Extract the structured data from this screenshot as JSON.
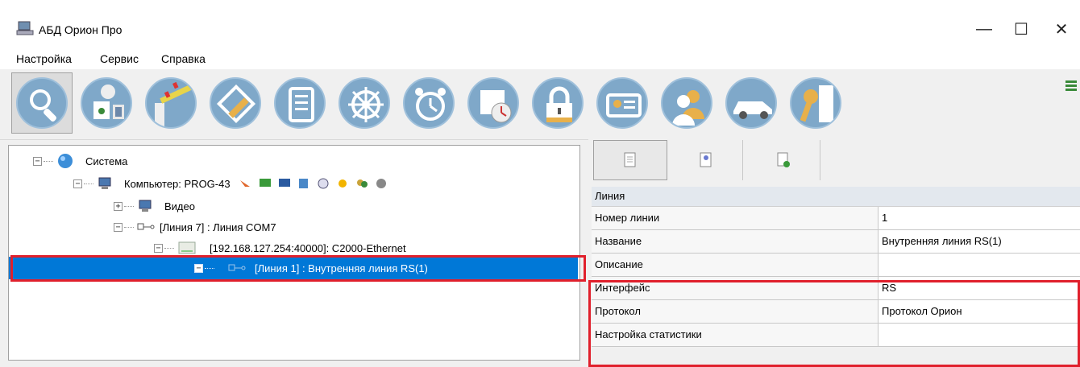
{
  "window": {
    "title": "АБД Орион Про",
    "minimize": "—",
    "maximize": "☐",
    "close": "✕"
  },
  "menu": [
    "Настройка",
    "Сервис",
    "Справка"
  ],
  "toolbar_icons": [
    "search-icon",
    "camera-icon",
    "barrier-icon",
    "plan-edit-icon",
    "document-icon",
    "wheel-icon",
    "alarm-clock-icon",
    "schedule-icon",
    "lock-icon",
    "id-card-icon",
    "users-icon",
    "car-icon",
    "key-icon"
  ],
  "tree": {
    "system": "Система",
    "computer": "Компьютер: PROG-43",
    "video": "Видео",
    "line7": "[Линия 7] : Линия COM7",
    "device": "[192.168.127.254:40000]: C2000-Ethernet",
    "line1": "[Линия 1] : Внутренняя линия RS(1)"
  },
  "properties": {
    "category": "Линия",
    "rows": [
      {
        "name": "Номер линии",
        "value": "1"
      },
      {
        "name": "Название",
        "value": "Внутренняя линия RS(1)"
      },
      {
        "name": "Описание",
        "value": ""
      },
      {
        "name": "Интерфейс",
        "value": "RS"
      },
      {
        "name": "Протокол",
        "value": "Протокол Орион"
      },
      {
        "name": "Настройка статистики",
        "value": ""
      }
    ]
  },
  "colors": {
    "selection": "#0078d7",
    "highlight_box": "#e0202c",
    "tool_circle": "#7fa8c9"
  }
}
